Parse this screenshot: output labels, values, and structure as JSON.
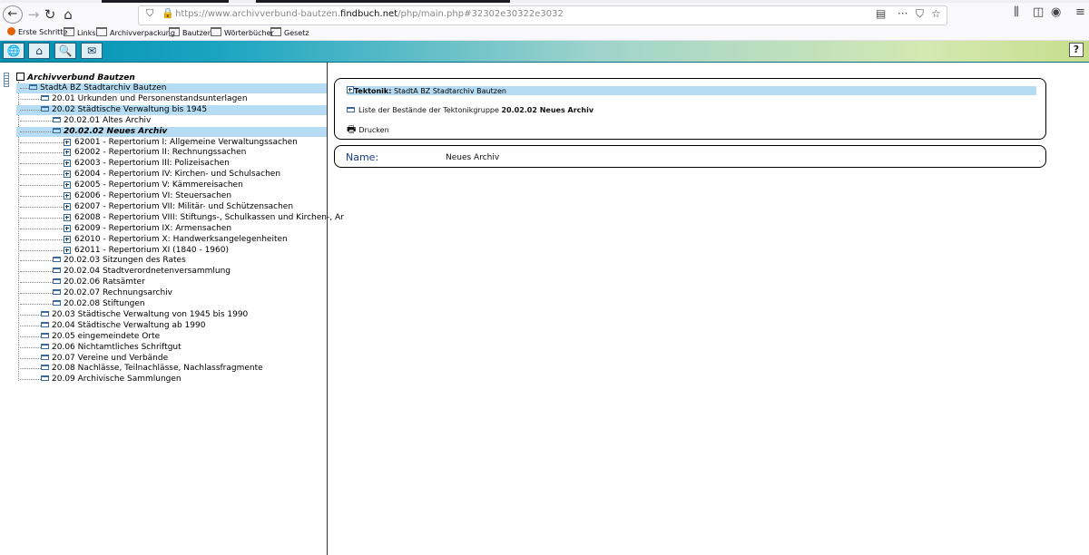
{
  "browser": {
    "url_host_prefix": "https://www.archivverbund-bautzen.",
    "url_host_main": "findbuch.net",
    "url_path": "/php/main.php#32302e30322e3032",
    "bookmarks": [
      "Erste Schritte",
      "Links",
      "Archivverpackung",
      "Bautzen",
      "Wörterbücher",
      "Gesetz"
    ]
  },
  "app": {
    "help_label": "?"
  },
  "tree": {
    "root": "Archivverbund Bautzen",
    "items": [
      {
        "label": "StadtA BZ Stadtarchiv Bautzen",
        "level": 1,
        "icon": "folder-open",
        "selected": true
      },
      {
        "label": "20.01 Urkunden und Personenstandsunterlagen",
        "level": 2,
        "icon": "folder"
      },
      {
        "label": "20.02 Städtische Verwaltung bis 1945",
        "level": 2,
        "icon": "folder-open",
        "selected": true
      },
      {
        "label": "20.02.01 Altes Archiv",
        "level": 3,
        "icon": "folder"
      },
      {
        "label": "20.02.02 Neues Archiv",
        "level": 3,
        "icon": "folder-open",
        "selected": true,
        "current": true
      },
      {
        "label": "62001 - Repertorium I: Allgemeine Verwaltungssachen",
        "level": 4,
        "icon": "plus"
      },
      {
        "label": "62002 - Repertorium II: Rechnungssachen",
        "level": 4,
        "icon": "plus"
      },
      {
        "label": "62003 - Repertorium III: Polizeisachen",
        "level": 4,
        "icon": "plus"
      },
      {
        "label": "62004 - Repertorium IV: Kirchen- und Schulsachen",
        "level": 4,
        "icon": "plus"
      },
      {
        "label": "62005 - Repertorium V: Kämmereisachen",
        "level": 4,
        "icon": "plus"
      },
      {
        "label": "62006 - Repertorium VI: Steuersachen",
        "level": 4,
        "icon": "plus"
      },
      {
        "label": "62007 - Repertorium VII: Militär- und Schützensachen",
        "level": 4,
        "icon": "plus"
      },
      {
        "label": "62008 - Repertorium VIII: Stiftungs-, Schulkassen und Kirchen-, Ar",
        "level": 4,
        "icon": "plus"
      },
      {
        "label": "62009 - Repertorium IX: Armensachen",
        "level": 4,
        "icon": "plus"
      },
      {
        "label": "62010 - Repertorium X: Handwerksangelegenheiten",
        "level": 4,
        "icon": "plus"
      },
      {
        "label": "62011 - Repertorium XI (1840 - 1960)",
        "level": 4,
        "icon": "plus"
      },
      {
        "label": "20.02.03 Sitzungen des Rates",
        "level": 3,
        "icon": "folder"
      },
      {
        "label": "20.02.04 Stadtverordnetenversammlung",
        "level": 3,
        "icon": "folder"
      },
      {
        "label": "20.02.06 Ratsämter",
        "level": 3,
        "icon": "folder"
      },
      {
        "label": "20.02.07 Rechnungsarchiv",
        "level": 3,
        "icon": "folder"
      },
      {
        "label": "20.02.08 Stiftungen",
        "level": 3,
        "icon": "folder"
      },
      {
        "label": "20.03 Städtische Verwaltung von 1945 bis 1990",
        "level": 2,
        "icon": "folder"
      },
      {
        "label": "20.04 Städtische Verwaltung ab 1990",
        "level": 2,
        "icon": "folder"
      },
      {
        "label": "20.05 eingemeindete Orte",
        "level": 2,
        "icon": "folder"
      },
      {
        "label": "20.06 Nichtamtliches Schriftgut",
        "level": 2,
        "icon": "folder"
      },
      {
        "label": "20.07 Vereine und Verbände",
        "level": 2,
        "icon": "folder"
      },
      {
        "label": "20.08 Nachlässe, Teilnachlässe, Nachlassfragmente",
        "level": 2,
        "icon": "folder"
      },
      {
        "label": "20.09 Archivische Sammlungen",
        "level": 2,
        "icon": "folder"
      }
    ]
  },
  "detail": {
    "tektonik_label": "Tektonik:",
    "tektonik_value": "StadtA BZ Stadtarchiv Bautzen",
    "list_text": "Liste der Bestände der Tektonikgruppe",
    "list_group": "20.02.02 Neues Archiv",
    "print_label": "Drucken",
    "name_key": "Name:",
    "name_value": "Neues Archiv"
  }
}
